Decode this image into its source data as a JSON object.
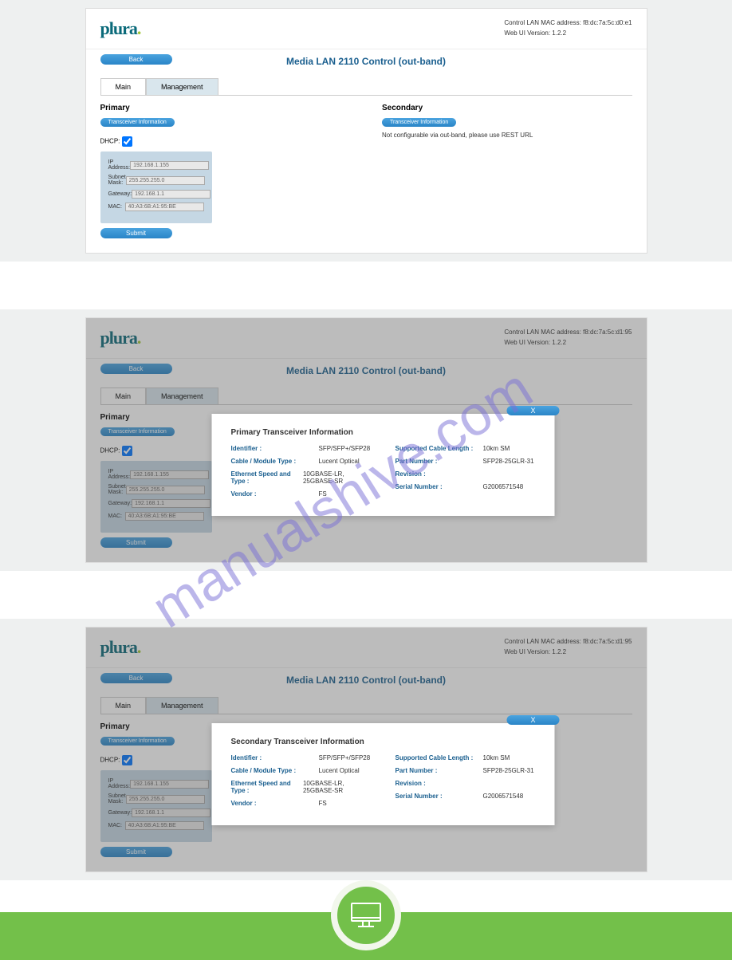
{
  "header": {
    "logo_text": "plura",
    "mac_line_prefix": "Control LAN MAC address: ",
    "mac1": "f8:dc:7a:5c:d0:e1",
    "mac2": "f8:dc:7a:5c:d1:95",
    "mac3": "f8:dc:7a:5c:d1:95",
    "version_label": "Web UI Version: 1.2.2"
  },
  "title": "Media LAN 2110 Control (out-band)",
  "back_btn": "Back",
  "tabs": {
    "main": "Main",
    "management": "Management"
  },
  "primary": {
    "label": "Primary",
    "ti_btn": "Transceiver Information",
    "dhcp_label": "DHCP:",
    "ip_label": "IP Address:",
    "ip_val": "192.168.1.155",
    "mask_label": "Subnet Mask:",
    "mask_val": "255.255.255.0",
    "gw_label": "Gateway:",
    "gw_val": "192.168.1.1",
    "mac_label": "MAC:",
    "mac_val": "40:A3:6B:A1:95:BE",
    "submit": "Submit"
  },
  "secondary": {
    "label": "Secondary",
    "ti_btn": "Transceiver Information",
    "note": "Not configurable via out-band, please use REST URL"
  },
  "modal_primary": {
    "title": "Primary Transceiver Information",
    "close": "X",
    "identifier_k": "Identifier :",
    "identifier_v": "SFP/SFP+/SFP28",
    "cable_k": "Cable / Module Type :",
    "cable_v": "Lucent Optical",
    "eth_k": "Ethernet Speed and Type :",
    "eth_v": "10GBASE-LR, 25GBASE-SR",
    "vendor_k": "Vendor :",
    "vendor_v": "FS",
    "scl_k": "Supported Cable Length :",
    "scl_v": "10km SM",
    "part_k": "Part Number :",
    "part_v": "SFP28-25GLR-31",
    "rev_k": "Revision :",
    "rev_v": "",
    "sn_k": "Serial Number :",
    "sn_v": "G2006571548"
  },
  "modal_secondary": {
    "title": "Secondary Transceiver Information",
    "close": "X",
    "identifier_k": "Identifier :",
    "identifier_v": "SFP/SFP+/SFP28",
    "cable_k": "Cable / Module Type :",
    "cable_v": "Lucent Optical",
    "eth_k": "Ethernet Speed and Type :",
    "eth_v": "10GBASE-LR, 25GBASE-SR",
    "vendor_k": "Vendor :",
    "vendor_v": "FS",
    "scl_k": "Supported Cable Length :",
    "scl_v": "10km SM",
    "part_k": "Part Number :",
    "part_v": "SFP28-25GLR-31",
    "rev_k": "Revision :",
    "rev_v": "",
    "sn_k": "Serial Number :",
    "sn_v": "G2006571548"
  },
  "watermark": "manualshive.com"
}
